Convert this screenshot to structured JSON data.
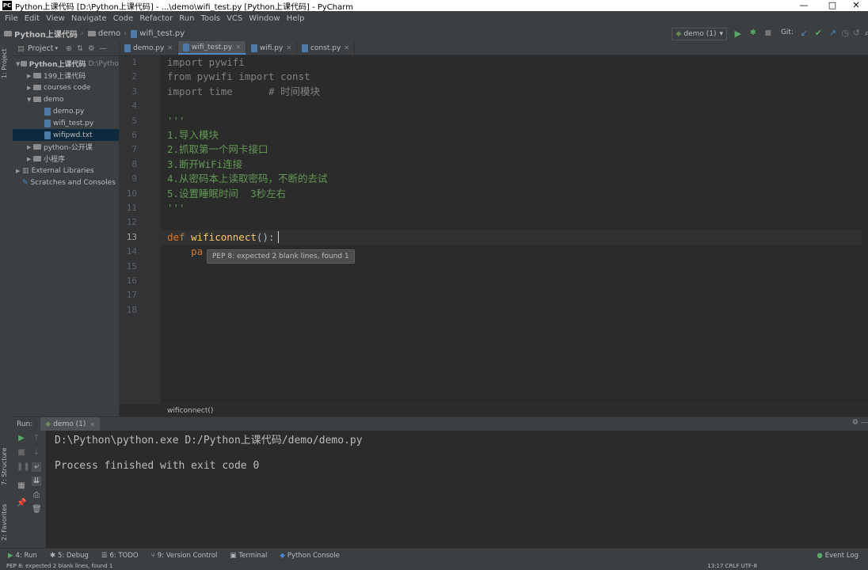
{
  "window": {
    "title": "Python上课代码 [D:\\Python上课代码] - ...\\demo\\wifi_test.py [Python上课代码] - PyCharm",
    "logo": "PC",
    "minimize": "—",
    "maximize": "□",
    "close": "✕"
  },
  "menu": [
    "File",
    "Edit",
    "View",
    "Navigate",
    "Code",
    "Refactor",
    "Run",
    "Tools",
    "VCS",
    "Window",
    "Help"
  ],
  "breadcrumb": [
    "Python上课代码",
    "demo",
    "wifi_test.py"
  ],
  "toolbar": {
    "run_config": "demo (1)",
    "git_label": "Git:"
  },
  "project_panel": {
    "title": "Project",
    "tree": [
      {
        "label": "Python上课代码",
        "suffix": "D:\\Pytho",
        "indent": 0,
        "type": "folder",
        "expanded": true,
        "bold": true
      },
      {
        "label": "199上课代码",
        "indent": 1,
        "type": "folder",
        "expanded": false
      },
      {
        "label": "courses code",
        "indent": 1,
        "type": "folder",
        "expanded": false
      },
      {
        "label": "demo",
        "indent": 1,
        "type": "folder",
        "expanded": true
      },
      {
        "label": "demo.py",
        "indent": 2,
        "type": "file"
      },
      {
        "label": "wifi_test.py",
        "indent": 2,
        "type": "file"
      },
      {
        "label": "wifipwd.txt",
        "indent": 2,
        "type": "file",
        "selected": true
      },
      {
        "label": "python-公开课",
        "indent": 1,
        "type": "folder",
        "expanded": false
      },
      {
        "label": "小程序",
        "indent": 1,
        "type": "folder",
        "expanded": false
      },
      {
        "label": "External Libraries",
        "indent": 0,
        "type": "lib",
        "expanded": false
      },
      {
        "label": "Scratches and Consoles",
        "indent": 0,
        "type": "scratch"
      }
    ]
  },
  "left_strip": {
    "project_tab": "1: Project",
    "structure_tab": "7: Structure",
    "favorites_tab": "2: Favorites"
  },
  "tabs": [
    {
      "label": "demo.py",
      "active": false
    },
    {
      "label": "wifi_test.py",
      "active": true
    },
    {
      "label": "wifi.py",
      "active": false
    },
    {
      "label": "const.py",
      "active": false
    }
  ],
  "editor": {
    "line_numbers": [
      "1",
      "2",
      "3",
      "4",
      "5",
      "6",
      "7",
      "8",
      "9",
      "10",
      "11",
      "12",
      "13",
      "14",
      "15",
      "16",
      "17",
      "18"
    ],
    "lines": {
      "l1_a": "import",
      "l1_b": " pywifi",
      "l2_a": "from",
      "l2_b": " pywifi ",
      "l2_c": "import",
      "l2_d": " const",
      "l3_a": "import",
      "l3_b": " time      ",
      "l3_c": "# 时间模块",
      "l5": "'''",
      "l6": "1.导入模块",
      "l7": "2.抓取第一个网卡接口",
      "l8": "3.断开WiFi连接",
      "l9": "4.从密码本上读取密码，不断的去试",
      "l10": "5.设置睡眠时间  3秒左右",
      "l11": "'''",
      "l13_a": "def",
      "l13_b": " wificonnect",
      "l13_c": "():",
      "l14": "    pa"
    },
    "tooltip": "PEP 8: expected 2 blank lines, found 1",
    "breadcrumb_bottom": "wificonnect()"
  },
  "run_panel": {
    "label": "Run:",
    "tab": "demo (1)",
    "output": [
      "D:\\Python\\python.exe D:/Python上课代码/demo/demo.py",
      "",
      "Process finished with exit code 0"
    ]
  },
  "bottom_tabs": [
    "4: Run",
    "5: Debug",
    "6: TODO",
    "9: Version Control",
    "Terminal",
    "Python Console"
  ],
  "event_log": "Event Log",
  "status": {
    "message": "PEP 8: expected 2 blank lines, found 1",
    "position": "13:17  CRLF  UTF-8"
  }
}
